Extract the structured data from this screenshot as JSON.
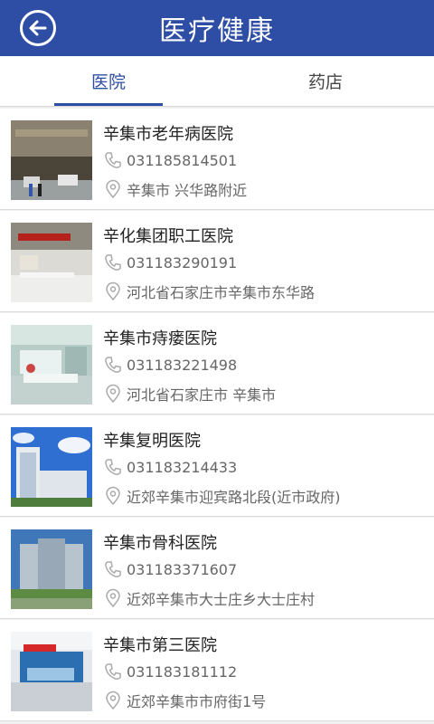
{
  "header": {
    "title": "医疗健康"
  },
  "tabs": [
    {
      "label": "医院",
      "active": true
    },
    {
      "label": "药店",
      "active": false
    }
  ],
  "colors": {
    "accent": "#2d4ea4"
  },
  "hospitals": [
    {
      "name": "辛集市老年病医院",
      "phone": "031185814501",
      "address": "辛集市 兴华路附近"
    },
    {
      "name": "辛化集团职工医院",
      "phone": "031183290191",
      "address": "河北省石家庄市辛集市东华路"
    },
    {
      "name": "辛集市痔瘘医院",
      "phone": "031183221498",
      "address": "河北省石家庄市 辛集市"
    },
    {
      "name": "辛集复明医院",
      "phone": "031183214433",
      "address": "近郊辛集市迎宾路北段(近市政府)"
    },
    {
      "name": "辛集市骨科医院",
      "phone": "031183371607",
      "address": "近郊辛集市大士庄乡大士庄村"
    },
    {
      "name": "辛集市第三医院",
      "phone": "031183181112",
      "address": "近郊辛集市市府街1号"
    }
  ]
}
